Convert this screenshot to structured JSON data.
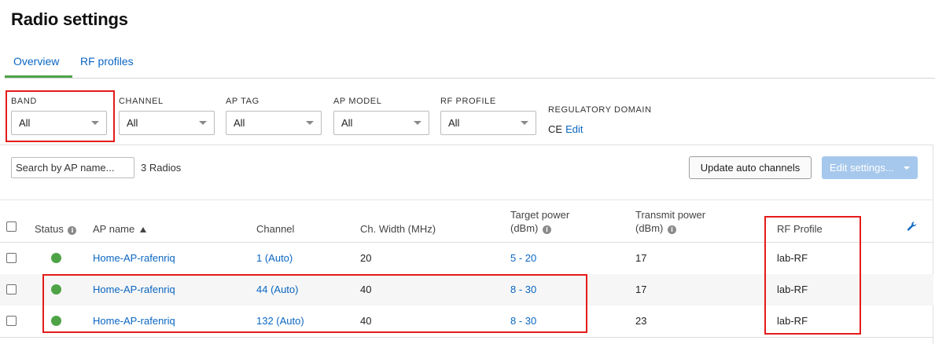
{
  "page": {
    "title": "Radio settings"
  },
  "tabs": [
    {
      "label": "Overview",
      "active": true
    },
    {
      "label": "RF profiles",
      "active": false
    }
  ],
  "filters": [
    {
      "label": "BAND",
      "value": "All"
    },
    {
      "label": "CHANNEL",
      "value": "All"
    },
    {
      "label": "AP TAG",
      "value": "All"
    },
    {
      "label": "AP MODEL",
      "value": "All"
    },
    {
      "label": "RF PROFILE",
      "value": "All"
    }
  ],
  "regulatory": {
    "label": "REGULATORY DOMAIN",
    "value": "CE",
    "edit_label": "Edit"
  },
  "toolbar": {
    "search_placeholder": "Search by AP name...",
    "count_text": "3 Radios",
    "update_label": "Update auto channels",
    "edit_label": "Edit settings..."
  },
  "table": {
    "columns": {
      "status": "Status",
      "ap_name": "AP name",
      "channel": "Channel",
      "width": "Ch. Width (MHz)",
      "target_power_line1": "Target power",
      "target_power_line2": "(dBm)",
      "transmit_power_line1": "Transmit power",
      "transmit_power_line2": "(dBm)",
      "rf_profile": "RF Profile"
    },
    "rows": [
      {
        "ap_name": "Home-AP-rafenriq",
        "channel": "1 (Auto)",
        "width": "20",
        "target_power": "5 - 20",
        "transmit_power": "17",
        "rf_profile": "lab-RF",
        "status_color": "#4ea347"
      },
      {
        "ap_name": "Home-AP-rafenriq",
        "channel": "44 (Auto)",
        "width": "40",
        "target_power": "8 - 30",
        "transmit_power": "17",
        "rf_profile": "lab-RF",
        "status_color": "#4ea347"
      },
      {
        "ap_name": "Home-AP-rafenriq",
        "channel": "132 (Auto)",
        "width": "40",
        "target_power": "8 - 30",
        "transmit_power": "23",
        "rf_profile": "lab-RF",
        "status_color": "#4ea347"
      }
    ]
  },
  "colors": {
    "link": "#0a66c2",
    "tab_underline": "#4ea347",
    "status_ok": "#4ea347",
    "highlight": "#e41b1b",
    "edit_button": "#a6c8ec"
  },
  "icons": {
    "info": "info-icon",
    "sort": "sort-ascending-icon",
    "wrench": "wrench-icon",
    "caret": "chevron-down-icon"
  }
}
